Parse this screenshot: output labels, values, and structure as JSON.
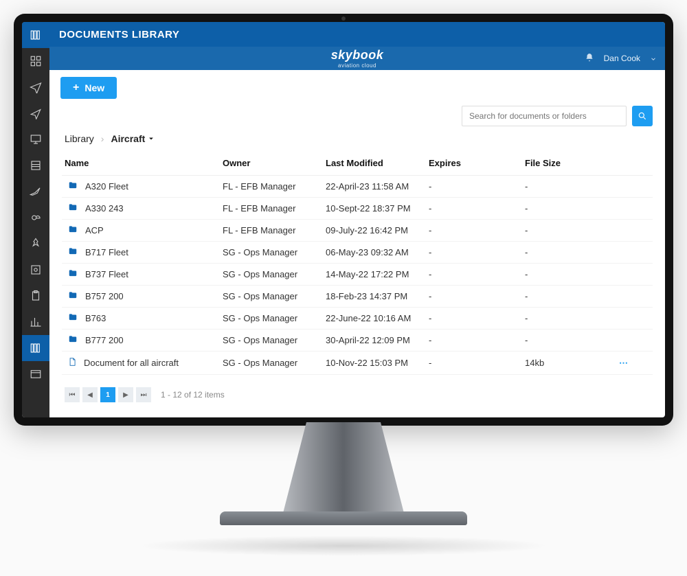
{
  "header": {
    "title": "DOCUMENTS LIBRARY"
  },
  "brand": {
    "name": "skybook",
    "subtitle": "aviation cloud"
  },
  "user": {
    "name": "Dan Cook"
  },
  "toolbar": {
    "new_label": "New"
  },
  "search": {
    "placeholder": "Search for documents or folders"
  },
  "breadcrumb": {
    "root": "Library",
    "current": "Aircraft"
  },
  "columns": {
    "name": "Name",
    "owner": "Owner",
    "last_modified": "Last Modified",
    "expires": "Expires",
    "file_size": "File Size"
  },
  "rows": [
    {
      "type": "folder",
      "name": "A320 Fleet",
      "owner": "FL - EFB Manager",
      "modified": "22-April-23 11:58 AM",
      "expires": "-",
      "size": "-"
    },
    {
      "type": "folder",
      "name": "A330 243",
      "owner": "FL - EFB Manager",
      "modified": "10-Sept-22 18:37 PM",
      "expires": "-",
      "size": "-"
    },
    {
      "type": "folder",
      "name": "ACP",
      "owner": "FL - EFB Manager",
      "modified": "09-July-22 16:42 PM",
      "expires": "-",
      "size": "-"
    },
    {
      "type": "folder",
      "name": "B717 Fleet",
      "owner": "SG - Ops Manager",
      "modified": "06-May-23 09:32 AM",
      "expires": "-",
      "size": "-"
    },
    {
      "type": "folder",
      "name": "B737 Fleet",
      "owner": "SG - Ops Manager",
      "modified": "14-May-22 17:22 PM",
      "expires": "-",
      "size": "-"
    },
    {
      "type": "folder",
      "name": "B757 200",
      "owner": "SG - Ops Manager",
      "modified": "18-Feb-23 14:37 PM",
      "expires": "-",
      "size": "-"
    },
    {
      "type": "folder",
      "name": "B763",
      "owner": "SG - Ops Manager",
      "modified": "22-June-22 10:16 AM",
      "expires": "-",
      "size": "-"
    },
    {
      "type": "folder",
      "name": "B777 200",
      "owner": "SG - Ops Manager",
      "modified": "30-April-22 12:09 PM",
      "expires": "-",
      "size": "-"
    },
    {
      "type": "document",
      "name": "Document for all aircraft",
      "owner": "SG - Ops Manager",
      "modified": "10-Nov-22 15:03 PM",
      "expires": "-",
      "size": "14kb",
      "more": "true"
    }
  ],
  "pager": {
    "page": "1",
    "summary": "1 - 12 of 12 items"
  }
}
